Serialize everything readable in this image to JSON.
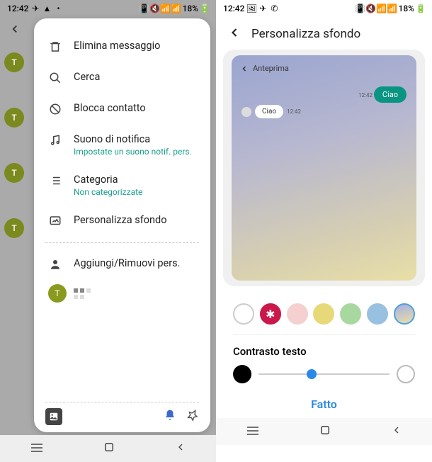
{
  "status": {
    "time": "12:42",
    "battery": "18%"
  },
  "left": {
    "back_letter": "T",
    "menu": {
      "delete": "Elimina messaggio",
      "search": "Cerca",
      "block": "Blocca contatto",
      "notif": {
        "label": "Suono di notifica",
        "sub": "Impostate un suono notif. pers."
      },
      "category": {
        "label": "Categoria",
        "sub": "Non categorizzate"
      },
      "wallpaper": "Personalizza sfondo",
      "addremove": "Aggiungi/Rimuovi pers."
    },
    "avatar_letter": "T"
  },
  "right": {
    "title": "Personalizza sfondo",
    "preview_label": "Anteprima",
    "bubble_out": "Ciao",
    "bubble_in": "Ciao",
    "time_stamp": "12:42",
    "contrast_label": "Contrasto testo",
    "done": "Fatto"
  }
}
